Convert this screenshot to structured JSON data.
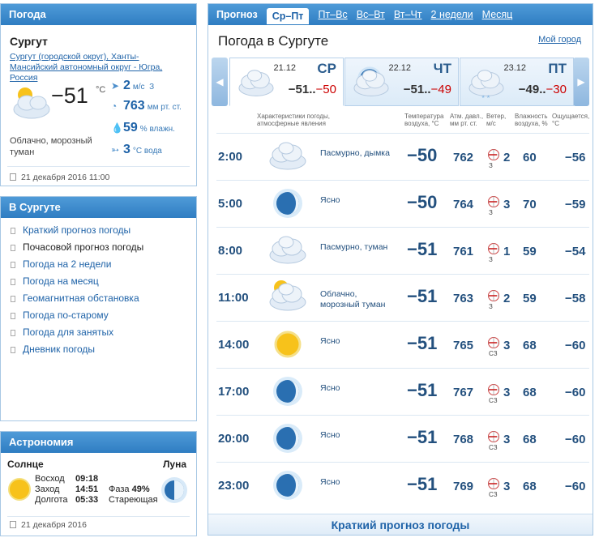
{
  "weather_box": {
    "title": "Погода",
    "city": "Сургут",
    "region": "Сургут (городской округ), Ханты-Мансийский автономный округ - Югра, Россия",
    "temp": "−51",
    "unit": "°C",
    "wind_value": "2",
    "wind_unit": "м/с",
    "wind_dir": "З",
    "pressure_value": "763",
    "pressure_unit": "мм рт. ст.",
    "humidity_value": "59",
    "humidity_unit": "% влажн.",
    "water_value": "3",
    "water_unit": "°С вода",
    "description": "Облачно, морозный туман",
    "updated": "21 декабря 2016 11:00"
  },
  "menu_box": {
    "title": "В Сургуте",
    "items": [
      {
        "label": "Краткий прогноз погоды",
        "current": false
      },
      {
        "label": "Почасовой прогноз погоды",
        "current": true
      },
      {
        "label": "Погода на 2 недели",
        "current": false
      },
      {
        "label": "Погода на месяц",
        "current": false
      },
      {
        "label": "Геомагнитная обстановка",
        "current": false
      },
      {
        "label": "Погода по-старому",
        "current": false
      },
      {
        "label": "Погода для занятых",
        "current": false
      },
      {
        "label": "Дневник погоды",
        "current": false
      }
    ]
  },
  "astro_box": {
    "title": "Астрономия",
    "sun_label": "Солнце",
    "moon_label": "Луна",
    "sunrise_label": "Восход",
    "sunrise": "09:18",
    "sunset_label": "Заход",
    "sunset": "14:51",
    "daylength_label": "Долгота",
    "daylength": "05:33",
    "phase_label": "Фаза",
    "phase": "49%",
    "phase_name": "Стареющая",
    "date": "21 декабря 2016"
  },
  "main": {
    "tabs": [
      {
        "label": "Прогноз",
        "kind": "lead"
      },
      {
        "label": "Ср–Пт",
        "kind": "active"
      },
      {
        "label": "Пт–Вс",
        "kind": "link"
      },
      {
        "label": "Вс–Вт",
        "kind": "link"
      },
      {
        "label": "Вт–Чт",
        "kind": "link"
      },
      {
        "label": "2 недели",
        "kind": "link"
      },
      {
        "label": "Месяц",
        "kind": "link"
      }
    ],
    "title": "Погода в Сургуте",
    "my_city": "Мой город",
    "days": [
      {
        "date": "21.12",
        "weekday": "СР",
        "tmin": "−51..",
        "tmax": "−50",
        "icon": "cloud-icon",
        "selected": true
      },
      {
        "date": "22.12",
        "weekday": "ЧТ",
        "tmin": "−51..",
        "tmax": "−49",
        "icon": "moon-cloud-icon",
        "selected": false
      },
      {
        "date": "23.12",
        "weekday": "ПТ",
        "tmin": "−49..",
        "tmax": "−30",
        "icon": "snow-cloud-icon",
        "selected": false
      }
    ],
    "columns": {
      "conditions": "Характеристики погоды, атмосферные явления",
      "temp": "Температура воздуха, °С",
      "pressure": "Атм. давл., мм рт. ст.",
      "wind": "Ветер, м/с",
      "humidity": "Влажность воздуха, %",
      "feels": "Ощущается, °С"
    },
    "rows": [
      {
        "time": "2:00",
        "icon": "cloud-icon",
        "desc": "Пасмурно, дымка",
        "temp": "−50",
        "pressure": "762",
        "wind_dir": "З",
        "wind": "2",
        "humidity": "60",
        "feels": "−56"
      },
      {
        "time": "5:00",
        "icon": "moon-icon",
        "desc": "Ясно",
        "temp": "−50",
        "pressure": "764",
        "wind_dir": "З",
        "wind": "3",
        "humidity": "70",
        "feels": "−59"
      },
      {
        "time": "8:00",
        "icon": "cloud-icon",
        "desc": "Пасмурно, туман",
        "temp": "−51",
        "pressure": "761",
        "wind_dir": "З",
        "wind": "1",
        "humidity": "59",
        "feels": "−54"
      },
      {
        "time": "11:00",
        "icon": "sun-cloud-icon",
        "desc": "Облачно, морозный туман",
        "temp": "−51",
        "pressure": "763",
        "wind_dir": "З",
        "wind": "2",
        "humidity": "59",
        "feels": "−58"
      },
      {
        "time": "14:00",
        "icon": "sun-icon",
        "desc": "Ясно",
        "temp": "−51",
        "pressure": "765",
        "wind_dir": "СЗ",
        "wind": "3",
        "humidity": "68",
        "feels": "−60"
      },
      {
        "time": "17:00",
        "icon": "moon-icon",
        "desc": "Ясно",
        "temp": "−51",
        "pressure": "767",
        "wind_dir": "СЗ",
        "wind": "3",
        "humidity": "68",
        "feels": "−60"
      },
      {
        "time": "20:00",
        "icon": "moon-icon",
        "desc": "Ясно",
        "temp": "−51",
        "pressure": "768",
        "wind_dir": "СЗ",
        "wind": "3",
        "humidity": "68",
        "feels": "−60"
      },
      {
        "time": "23:00",
        "icon": "moon-icon",
        "desc": "Ясно",
        "temp": "−51",
        "pressure": "769",
        "wind_dir": "СЗ",
        "wind": "3",
        "humidity": "68",
        "feels": "−60"
      }
    ],
    "bottom_link": "Краткий прогноз погоды"
  }
}
